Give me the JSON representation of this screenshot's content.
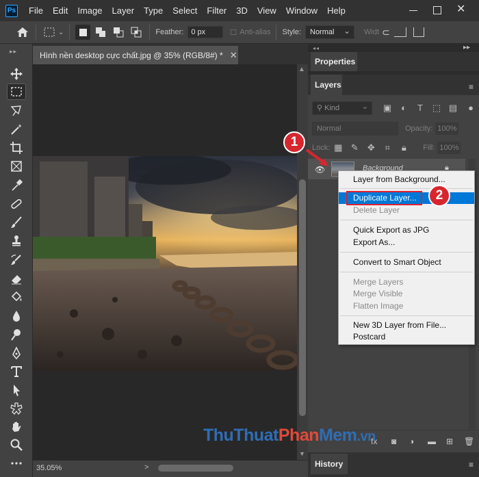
{
  "app": {
    "logo_text": "Ps"
  },
  "menubar": {
    "items": [
      "File",
      "Edit",
      "Image",
      "Layer",
      "Type",
      "Select",
      "Filter",
      "3D",
      "View",
      "Window",
      "Help"
    ]
  },
  "options_bar": {
    "feather_label": "Feather:",
    "feather_value": "0 px",
    "antialias_label": "Anti-alias",
    "style_label": "Style:",
    "style_value": "Normal",
    "width_label": "Widt"
  },
  "document": {
    "tab_title": "Hình nền desktop cực chất.jpg @ 35% (RGB/8#) *",
    "zoom": "35.05%",
    "status_arrow": ">"
  },
  "panels": {
    "properties_tab": "Properties",
    "layers_tab": "Layers",
    "history_tab": "History",
    "filter_kind": "Kind",
    "blend_mode": "Normal",
    "opacity_label": "Opacity:",
    "opacity_value": "100%",
    "lock_label": "Lock:",
    "fill_label": "Fill:",
    "fill_value": "100%",
    "layer_name": "Background"
  },
  "context_menu": {
    "items": [
      {
        "label": "Layer from Background...",
        "enabled": true
      },
      {
        "label": "Duplicate Layer...",
        "enabled": true,
        "highlighted": true
      },
      {
        "label": "Delete Layer",
        "enabled": false
      },
      {
        "label": "Quick Export as JPG",
        "enabled": true
      },
      {
        "label": "Export As...",
        "enabled": true
      },
      {
        "label": "Convert to Smart Object",
        "enabled": true
      },
      {
        "label": "Merge Layers",
        "enabled": false
      },
      {
        "label": "Merge Visible",
        "enabled": false
      },
      {
        "label": "Flatten Image",
        "enabled": false
      },
      {
        "label": "New 3D Layer from File...",
        "enabled": true
      },
      {
        "label": "Postcard",
        "enabled": true
      }
    ]
  },
  "annotations": {
    "step1": "1",
    "step2": "2"
  },
  "watermark": {
    "part1": "Thu",
    "part2": "Thuat",
    "part3": "Phan",
    "part4": "Mem",
    "part5": ".vn"
  },
  "colors": {
    "accent": "#0078d7",
    "badge": "#d8262e",
    "ps_blue": "#31a8ff"
  }
}
